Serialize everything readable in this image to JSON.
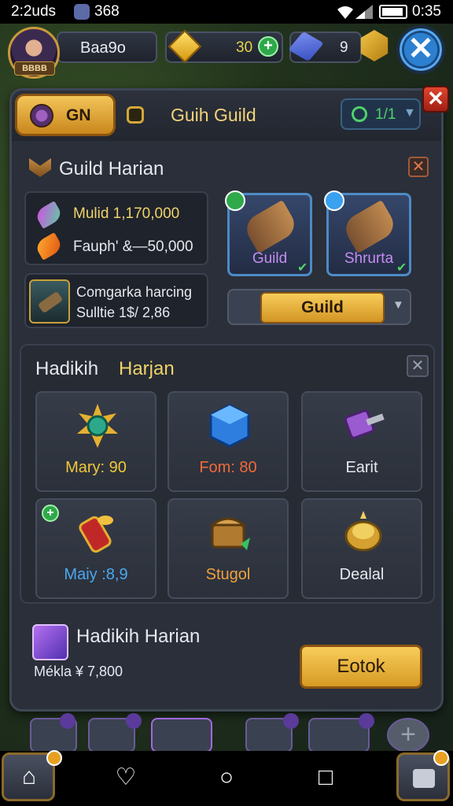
{
  "status_bar": {
    "time": "2:2uds",
    "badge": "̶38",
    "network_text": "368",
    "clock": "0:35"
  },
  "hud": {
    "avatar_name": "BBBB",
    "player_name": "Baa9o",
    "gems": "30",
    "keys": "9"
  },
  "header": {
    "tab_label": "GN",
    "title": "Guih Guild",
    "page": "1/1"
  },
  "section1": {
    "title": "Guild Harian",
    "reward1": "Mulid 1,170,000",
    "reward2": "Fauph' &—50,000",
    "box2_line1": "Comgarka harcing",
    "box2_line2": "Sulltie 1$/ 2,86",
    "card1_label": "Guild",
    "card2_label": "Shrurta",
    "guild_button": "Guild"
  },
  "section2": {
    "title_a": "Hadikih",
    "title_b": "Harjan",
    "tiles": [
      {
        "label": "Mary: 90",
        "color": "#f0c83a"
      },
      {
        "label": "Fom: 80",
        "color": "#f06a3a"
      },
      {
        "label": "Earit",
        "color": "#e6e8ee"
      },
      {
        "label": "Maiy :8,9",
        "color": "#4aa8f0"
      },
      {
        "label": "Stugol",
        "color": "#f0a040"
      },
      {
        "label": "Dealal",
        "color": "#e6e8ee"
      }
    ]
  },
  "section3": {
    "title": "Hadikih Harian",
    "price": "Mékla ¥ 7,800",
    "cta": "Eotok"
  },
  "nav": {
    "home": "⌂",
    "heart": "♡",
    "circle": "○",
    "square": "□"
  },
  "colors": {
    "gold": "#efd36a",
    "panel": "#2a2f3a",
    "accent": "#d69a24"
  },
  "icons": [
    "gem-icon",
    "key-icon",
    "hex-icon",
    "close-icon",
    "shield-icon",
    "chevron-down-icon",
    "gear-icon"
  ]
}
